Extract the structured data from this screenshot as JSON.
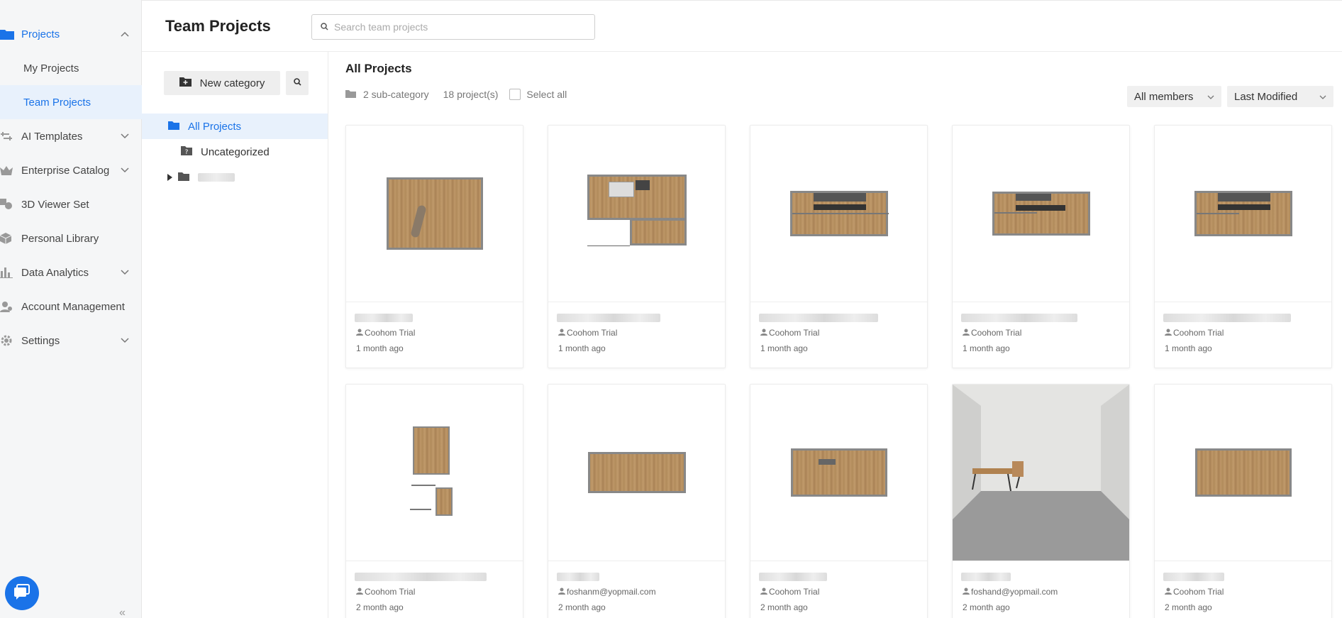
{
  "sidebar": {
    "items": [
      {
        "label": "Projects",
        "icon": "folder-icon",
        "expanded": true
      },
      {
        "label": "My Projects"
      },
      {
        "label": "Team Projects",
        "selected": true
      },
      {
        "label": "AI Templates",
        "icon": "ai-icon"
      },
      {
        "label": "Enterprise Catalog",
        "icon": "crown-icon"
      },
      {
        "label": "3D Viewer Set",
        "icon": "shapes-icon"
      },
      {
        "label": "Personal Library",
        "icon": "box-icon"
      },
      {
        "label": "Data Analytics",
        "icon": "bar-chart-icon"
      },
      {
        "label": "Account Management",
        "icon": "user-icon"
      },
      {
        "label": "Settings",
        "icon": "gear-icon"
      }
    ],
    "collapse_label": "«"
  },
  "header": {
    "title": "Team Projects",
    "search_placeholder": "Search team projects"
  },
  "categories": {
    "new_category_label": "New category",
    "items": [
      {
        "label": "All Projects",
        "selected": true
      },
      {
        "label": "Uncategorized"
      }
    ]
  },
  "main": {
    "section_title": "All Projects",
    "sub_category_count": "2 sub-category",
    "project_count": "18 project(s)",
    "select_all_label": "Select all",
    "member_filter": "All members",
    "sort_filter": "Last Modified",
    "cards": [
      {
        "owner": "Coohom Trial",
        "time": "1 month ago"
      },
      {
        "owner": "Coohom Trial",
        "time": "1 month ago"
      },
      {
        "owner": "Coohom Trial",
        "time": "1 month ago"
      },
      {
        "owner": "Coohom Trial",
        "time": "1 month ago"
      },
      {
        "owner": "Coohom Trial",
        "time": "1 month ago"
      },
      {
        "owner": "Coohom Trial",
        "time": "2 month ago"
      },
      {
        "owner": "foshanm@yopmail.com",
        "time": "2 month ago"
      },
      {
        "owner": "Coohom Trial",
        "time": "2 month ago"
      },
      {
        "owner": "foshand@yopmail.com",
        "time": "2 month ago"
      },
      {
        "owner": "Coohom Trial",
        "time": "2 month ago"
      }
    ]
  },
  "colors": {
    "accent": "#1a73e8",
    "sidebar_bg": "#f5f6f7",
    "selected_bg": "#e8f1fc"
  }
}
